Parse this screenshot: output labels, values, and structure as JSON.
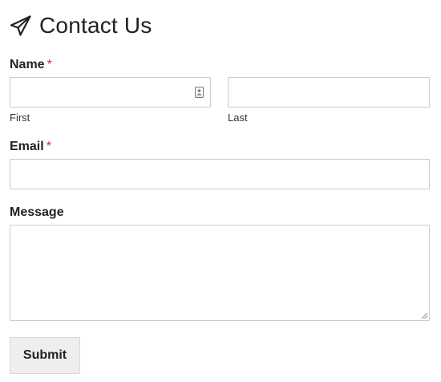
{
  "form": {
    "title": "Contact Us",
    "title_icon": "paper-plane-icon",
    "required_marker": "*",
    "name": {
      "label": "Name",
      "first": {
        "sublabel": "First",
        "value": "",
        "placeholder": "",
        "autofill_icon": "contact-card-icon"
      },
      "last": {
        "sublabel": "Last",
        "value": "",
        "placeholder": ""
      }
    },
    "email": {
      "label": "Email",
      "value": "",
      "placeholder": ""
    },
    "message": {
      "label": "Message",
      "value": "",
      "placeholder": ""
    },
    "submit_label": "Submit"
  },
  "colors": {
    "required": "#c9302c",
    "field_border": "#cccccc",
    "button_bg": "#eeeeee",
    "text": "#222222"
  }
}
